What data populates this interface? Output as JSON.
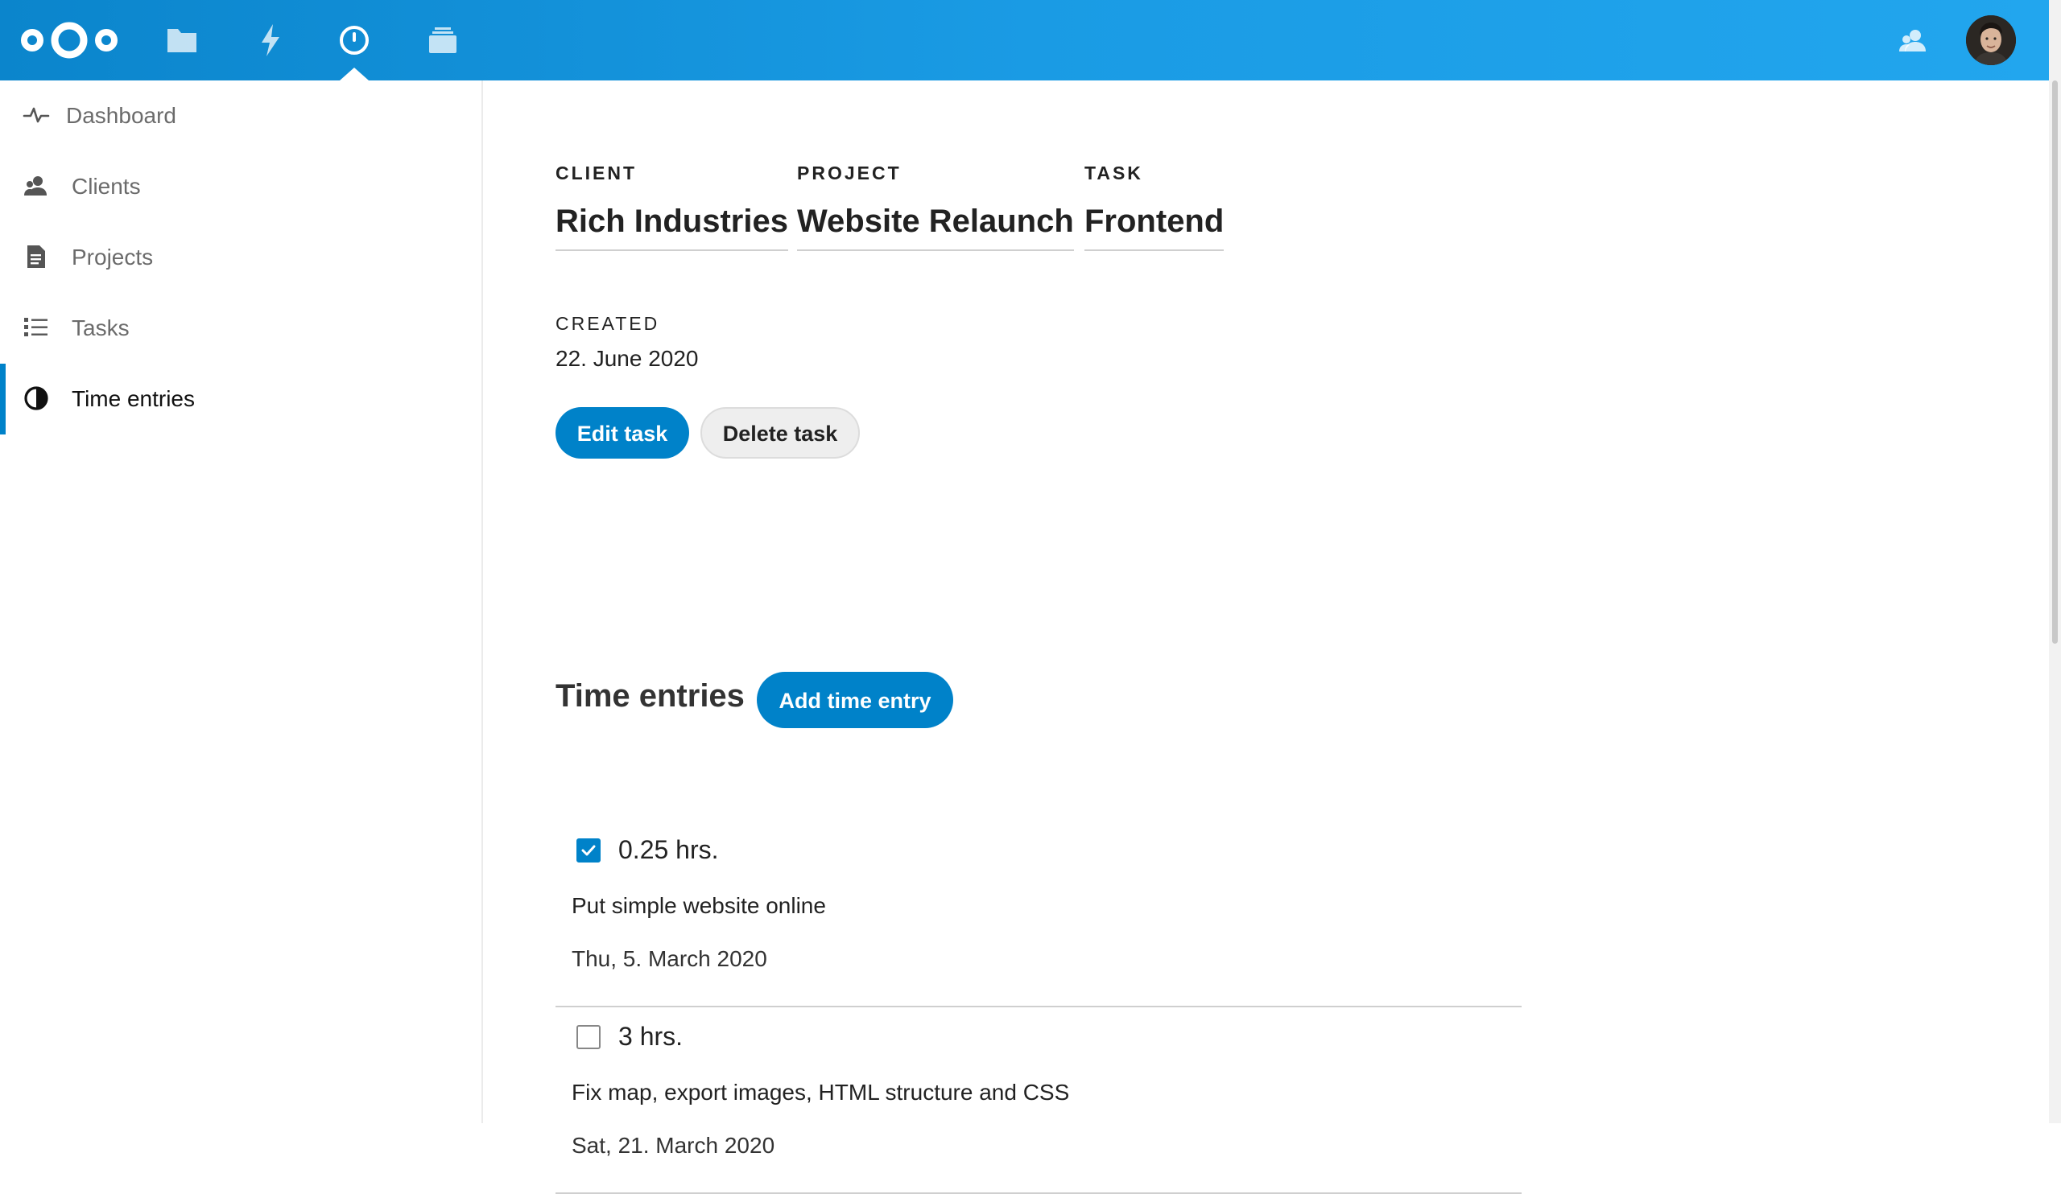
{
  "header": {
    "apps": [
      {
        "name": "Files",
        "icon": "folder-icon"
      },
      {
        "name": "Activity",
        "icon": "lightning-icon"
      },
      {
        "name": "Timemanager",
        "icon": "clock-icon",
        "active": true
      },
      {
        "name": "Deck",
        "icon": "deck-icon"
      }
    ],
    "contacts_icon": "contacts-icon",
    "avatar_icon": "user-avatar"
  },
  "sidebar": {
    "items": [
      {
        "label": "Dashboard",
        "icon": "pulse-icon"
      },
      {
        "label": "Clients",
        "icon": "people-icon"
      },
      {
        "label": "Projects",
        "icon": "document-icon"
      },
      {
        "label": "Tasks",
        "icon": "list-icon"
      },
      {
        "label": "Time entries",
        "icon": "pie-clock-icon",
        "active": true
      }
    ]
  },
  "task": {
    "client_label": "CLIENT",
    "client": "Rich Industries",
    "project_label": "PROJECT",
    "project": "Website Relaunch",
    "task_label": "TASK",
    "task": "Frontend",
    "created_label": "CREATED",
    "created": "22. June 2020",
    "edit_button": "Edit task",
    "delete_button": "Delete task"
  },
  "time_entries": {
    "title": "Time entries",
    "add_button": "Add time entry",
    "entries": [
      {
        "hours": "0.25 hrs.",
        "description": "Put simple website online",
        "date": "Thu, 5. March 2020",
        "checked": true
      },
      {
        "hours": "3 hrs.",
        "description": "Fix map, export images, HTML structure and CSS",
        "date": "Sat, 21. March 2020",
        "checked": false
      }
    ]
  },
  "colors": {
    "brand": "#0082c9",
    "header_start": "#0b85cc",
    "header_end": "#22a6ee"
  }
}
